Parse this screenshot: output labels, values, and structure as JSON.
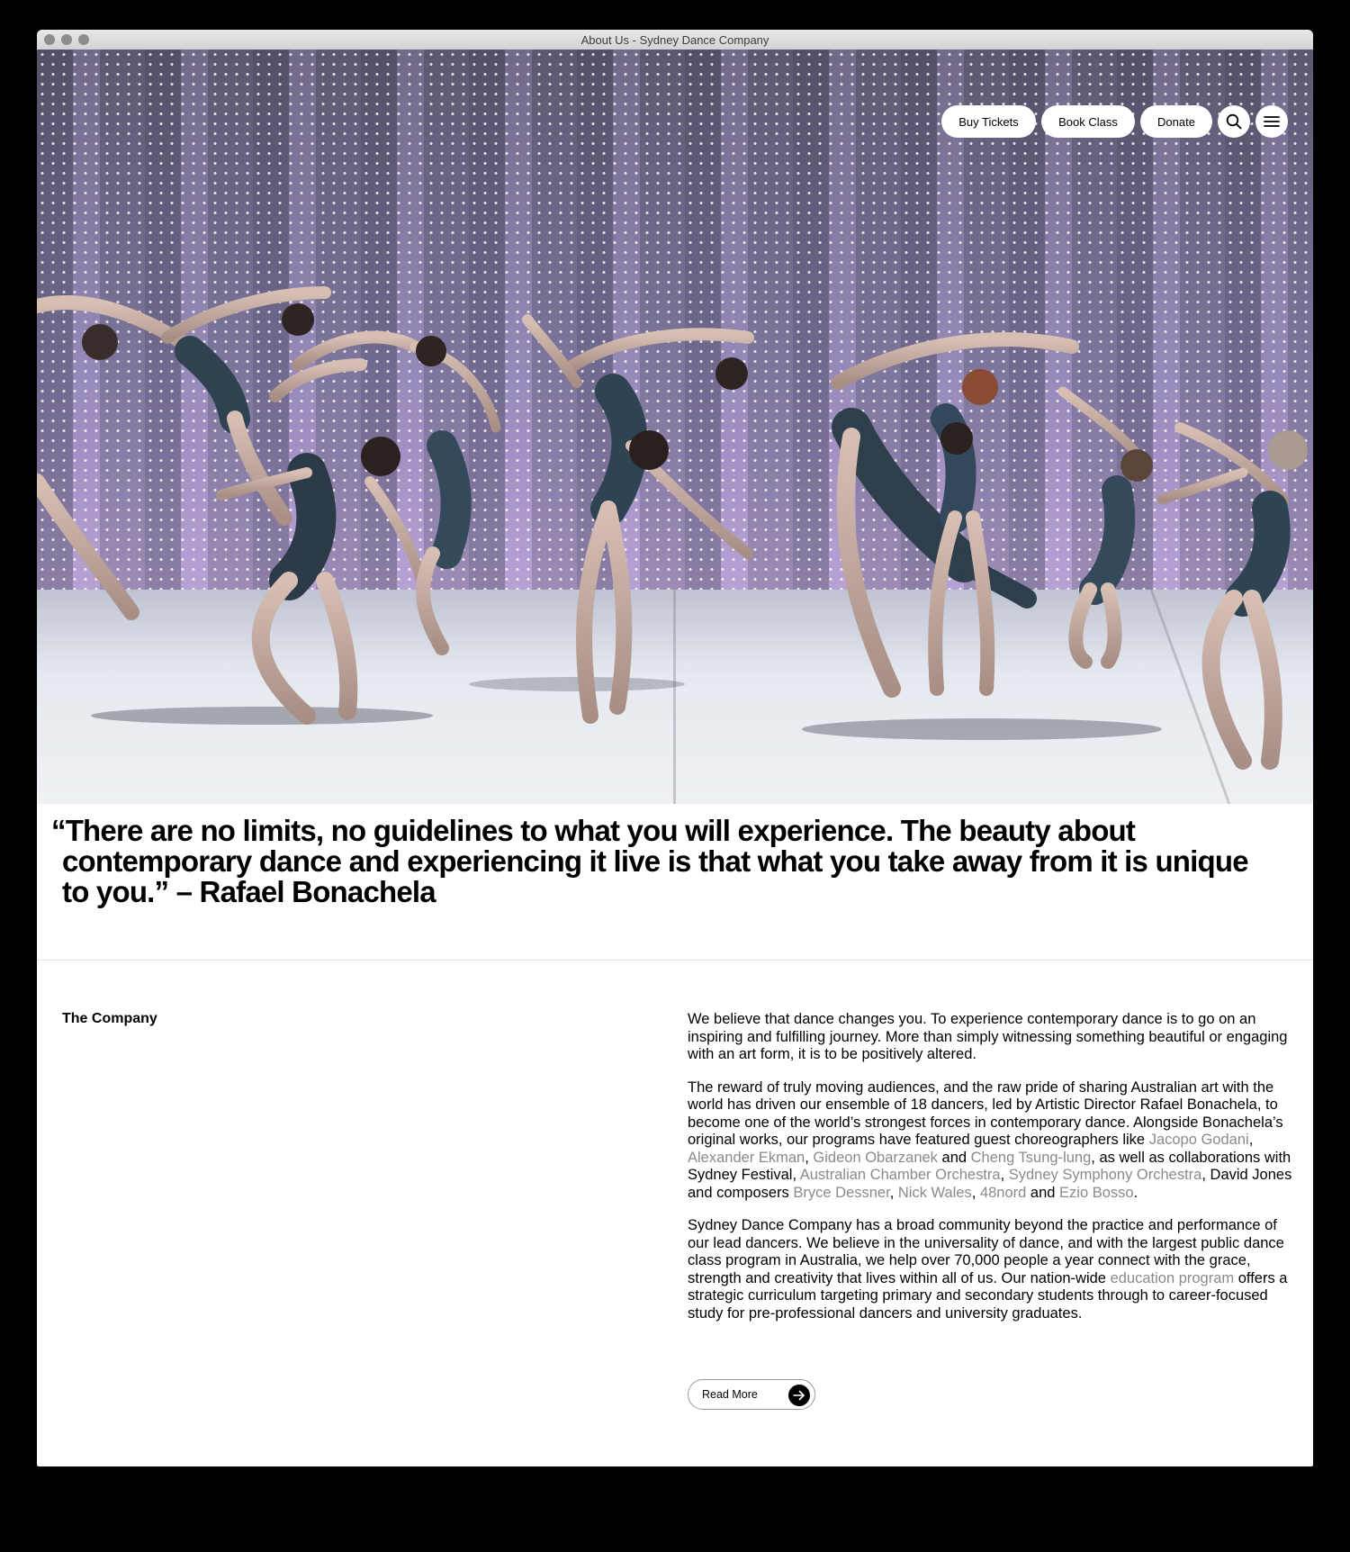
{
  "window": {
    "title": "About Us - Sydney Dance Company"
  },
  "nav": {
    "buy_tickets": "Buy Tickets",
    "book_class": "Book Class",
    "donate": "Donate",
    "search_icon": "search-icon",
    "menu_icon": "menu-icon"
  },
  "hero": {
    "image": "dancers-on-stage-photo"
  },
  "quote": {
    "line1": "“There are no limits, no guidelines to what you will experience. The beauty about",
    "line2": "contemporary dance and experiencing it live is that what you take away from it is unique",
    "line3": "to you.” – Rafael Bonachela"
  },
  "section": {
    "label": "The Company",
    "p1": "We believe that dance changes you. To experience contemporary dance is to go on an inspiring and fulfilling journey. More than simply witnessing something beautiful or engaging with an art form, it is to be positively altered.",
    "p2": {
      "t1": "The reward of truly moving audiences, and the raw pride of sharing Australian art with the world has driven our ensemble of 18 dancers, led by Artistic Director Rafael Bonachela, to become one of the world’s strongest forces in contemporary dance. Alongside Bonachela’s original works, our programs have featured guest choreographers like ",
      "l1": "Jacopo Godani",
      "s1": ", ",
      "l2": "Alexander Ekman",
      "s2": ", ",
      "l3": "Gideon Obarzanek",
      "s3": " and ",
      "l4": "Cheng Tsung-lung",
      "s4": ", as well as collaborations with Sydney Festival, ",
      "l5": "Australian Chamber Orchestra",
      "s5": ", ",
      "l6": "Sydney Symphony Orchestra",
      "s6": ", David Jones and composers ",
      "l7": "Bryce Dessner",
      "s7": ", ",
      "l8": "Nick Wales",
      "s8": ", ",
      "l9": "48nord",
      "s9": " and ",
      "l10": "Ezio Bosso",
      "s10": "."
    },
    "p3": {
      "t1": "Sydney Dance Company has a broad community beyond the practice and performance of our lead dancers. We believe in the universality of dance, and with the largest public dance class program in Australia, we help over 70,000 people a year connect with the grace, strength and creativity that lives within all of us. Our nation-wide ",
      "l1": "education program",
      "t2": " offers a strategic curriculum targeting primary and secondary students through to career-focused study for pre-professional dancers and university graduates."
    },
    "read_more": "Read More"
  },
  "colors": {
    "link": "#8a8a8a",
    "text": "#000000",
    "background": "#ffffff"
  }
}
